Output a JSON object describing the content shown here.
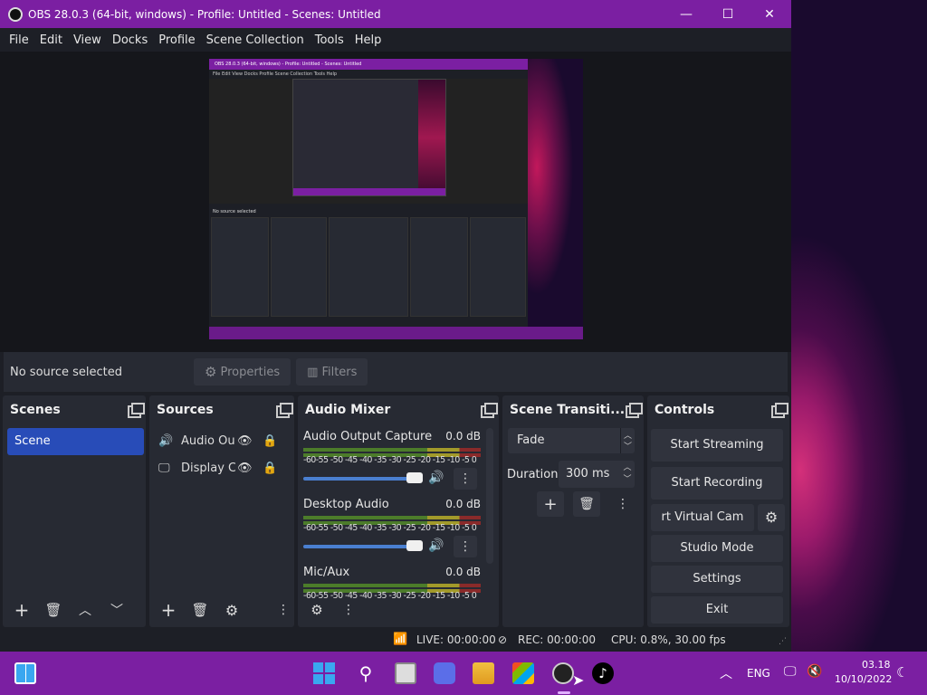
{
  "window": {
    "title": "OBS 28.0.3 (64-bit, windows) - Profile: Untitled - Scenes: Untitled",
    "minimize": "—",
    "maximize": "☐",
    "close": "✕"
  },
  "menu": [
    "File",
    "Edit",
    "View",
    "Docks",
    "Profile",
    "Scene Collection",
    "Tools",
    "Help"
  ],
  "preview": {
    "mini_title": "OBS 28.0.3 (64-bit, windows) - Profile: Untitled - Scenes: Untitled",
    "mini_menu": "File  Edit  View  Docks  Profile  Scene Collection  Tools  Help",
    "mini_no_source": "No source selected"
  },
  "propbar": {
    "no_source": "No source selected",
    "properties": "Properties",
    "filters": "Filters"
  },
  "scenes": {
    "title": "Scenes",
    "items": [
      "Scene"
    ]
  },
  "sources": {
    "title": "Sources",
    "items": [
      {
        "label": "Audio Ou",
        "icon": "speaker-icon"
      },
      {
        "label": "Display C",
        "icon": "monitor-icon"
      }
    ]
  },
  "mixer": {
    "title": "Audio Mixer",
    "ticks": "-60-55 -50 -45 -40 -35 -30 -25 -20 -15 -10 -5  0",
    "channels": [
      {
        "name": "Audio Output Capture",
        "db": "0.0 dB",
        "level": 0.95
      },
      {
        "name": "Desktop Audio",
        "db": "0.0 dB",
        "level": 0.95
      },
      {
        "name": "Mic/Aux",
        "db": "0.0 dB",
        "level": 0.95
      }
    ]
  },
  "transitions": {
    "title": "Scene Transiti...",
    "selected": "Fade",
    "duration_label": "Duration",
    "duration_value": "300 ms"
  },
  "controls": {
    "title": "Controls",
    "start_streaming": "Start Streaming",
    "start_recording": "Start Recording",
    "virtual_cam": "rt Virtual Cam",
    "studio_mode": "Studio Mode",
    "settings": "Settings",
    "exit": "Exit"
  },
  "status": {
    "live": "LIVE: 00:00:00",
    "rec": "REC: 00:00:00",
    "cpu": "CPU: 0.8%, 30.00 fps"
  },
  "taskbar": {
    "lang": "ENG",
    "time": "03.18",
    "date": "10/10/2022"
  },
  "colors": {
    "titlebar": "#7b1fa2",
    "accent": "#284cb8",
    "dock_bg": "#272a33"
  }
}
